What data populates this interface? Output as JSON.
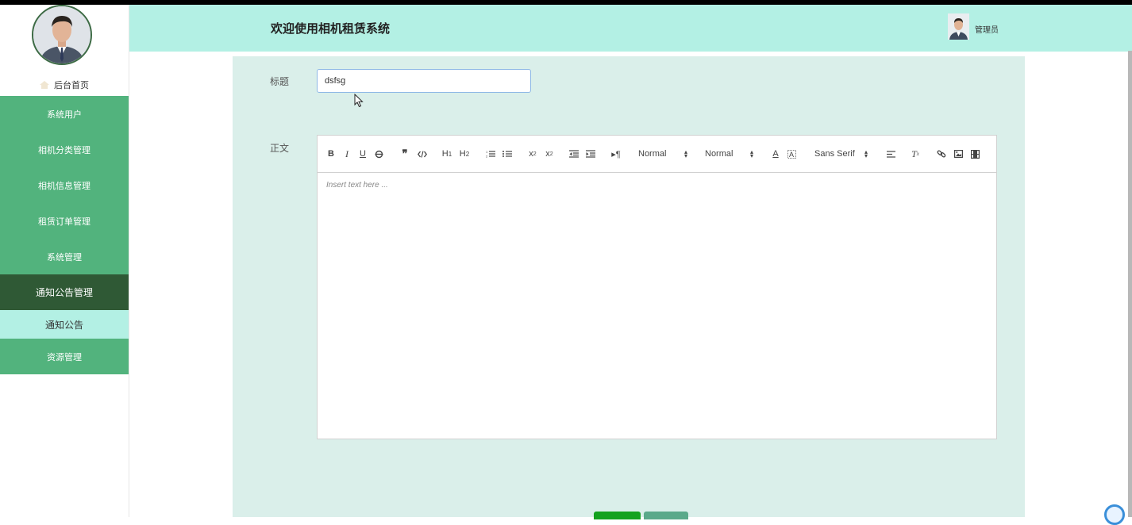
{
  "header": {
    "title": "欢迎使用相机租赁系统",
    "user_name": "管理员"
  },
  "sidebar": {
    "home_label": "后台首页",
    "menu": [
      {
        "label": "系统用户"
      },
      {
        "label": "相机分类管理"
      },
      {
        "label": "相机信息管理"
      },
      {
        "label": "租赁订单管理"
      },
      {
        "label": "系统管理"
      },
      {
        "label": "通知公告管理",
        "active": true
      },
      {
        "label": "通知公告",
        "submenu": true
      },
      {
        "label": "资源管理"
      }
    ]
  },
  "form": {
    "title_label": "标题",
    "title_value": "dsfsg",
    "body_label": "正文",
    "editor_placeholder": "Insert text here ...",
    "toolbar": {
      "header_picker": "Normal",
      "size_picker": "Normal",
      "font_picker": "Sans Serif"
    }
  },
  "colors": {
    "menu_bg": "#52b37d",
    "menu_active_bg": "#2f5935",
    "header_bg": "#b3f0e4",
    "content_bg": "#daefea",
    "primary_button": "#14a21f"
  }
}
